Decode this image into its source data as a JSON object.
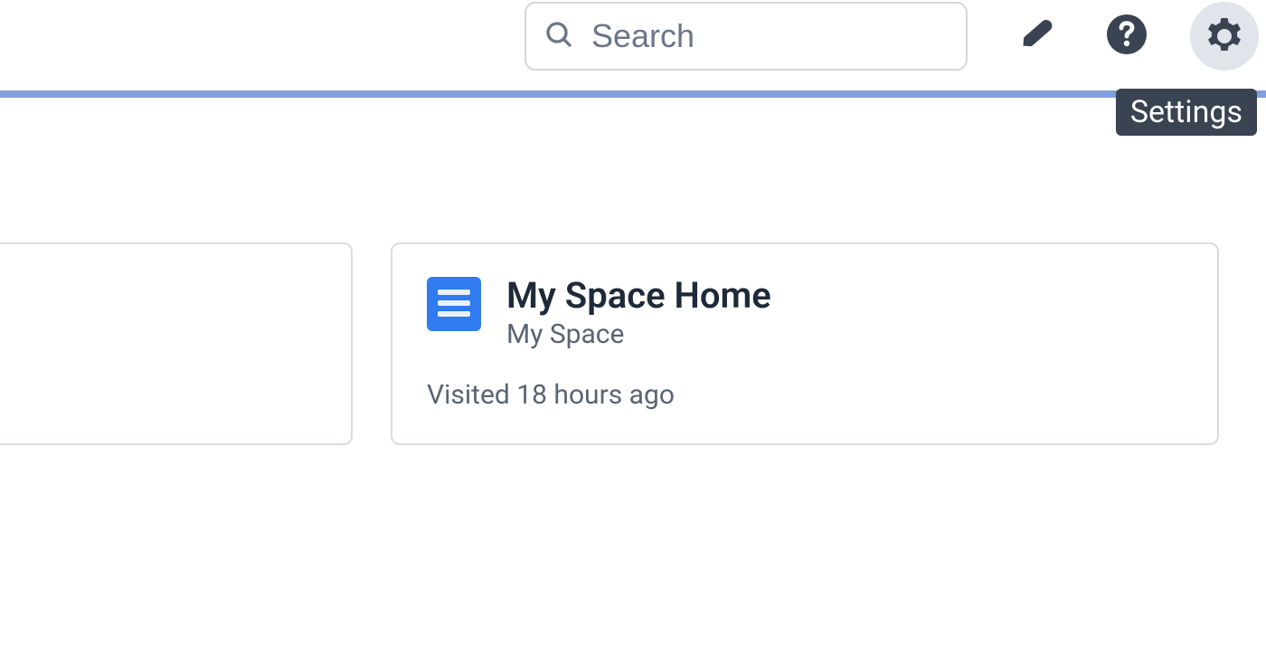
{
  "header": {
    "search_placeholder": "Search",
    "tooltip_settings": "Settings"
  },
  "cards": {
    "space_home": {
      "title": "My Space Home",
      "subtitle": "My Space",
      "visited": "Visited 18 hours ago"
    }
  }
}
